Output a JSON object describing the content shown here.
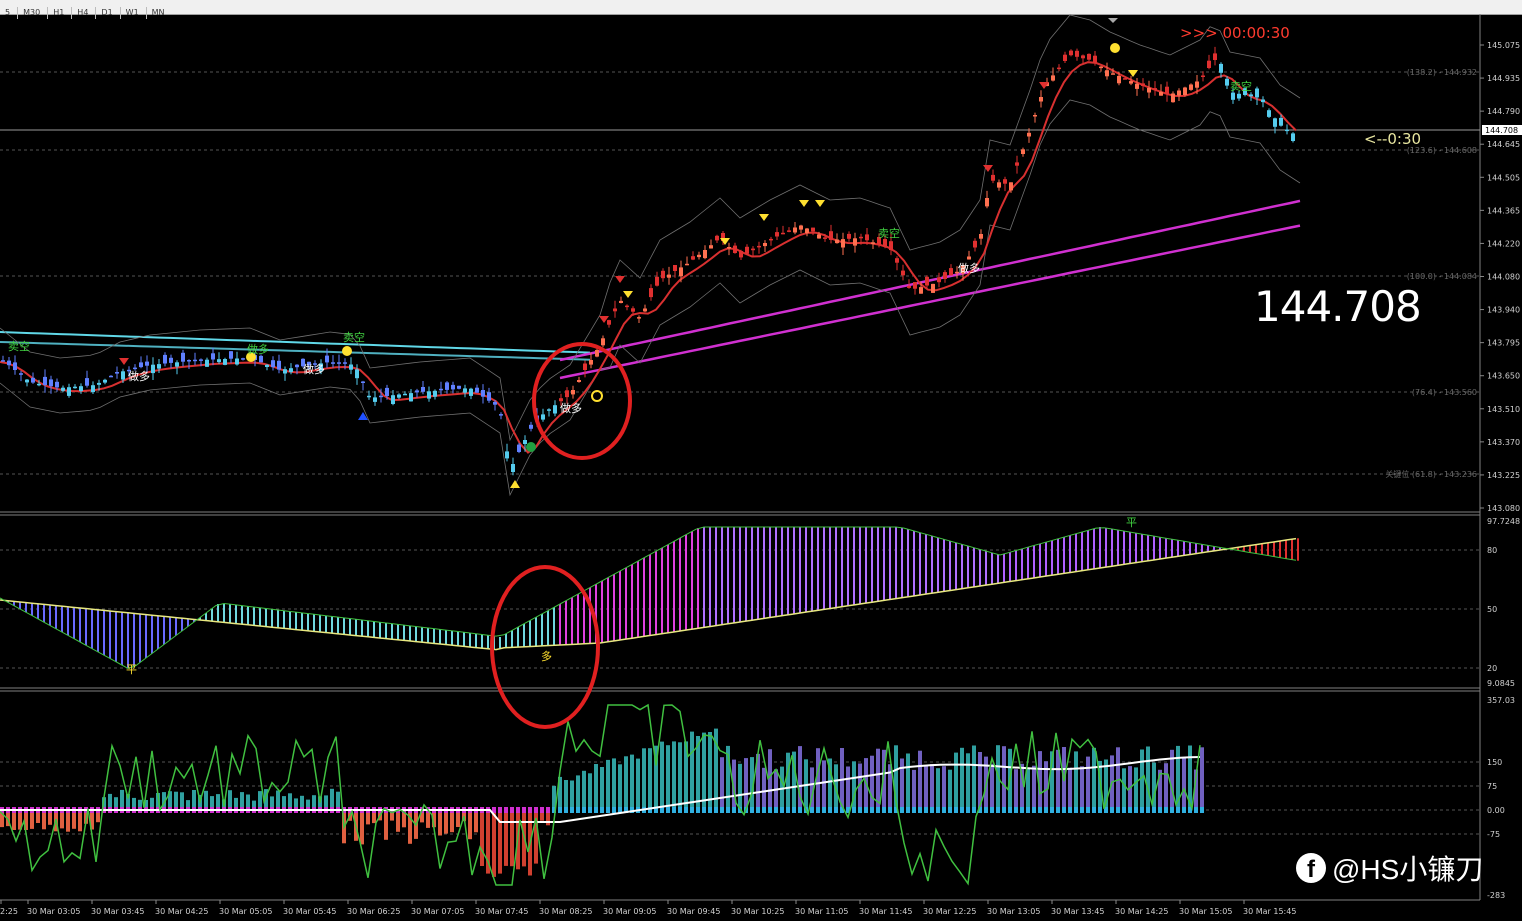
{
  "toolbar": {
    "timeframes": [
      "5",
      "M30",
      "H1",
      "H4",
      "D1",
      "W1",
      "MN"
    ]
  },
  "main_panel": {
    "current_price": "144.708",
    "big_price": "144.708",
    "countdown": ">>> 00:00:30",
    "side_timer": "<--0:30",
    "price_axis": [
      "145.075",
      "144.935",
      "144.790",
      "144.645",
      "144.505",
      "144.365",
      "144.220",
      "144.080",
      "143.940",
      "143.795",
      "143.650",
      "143.510",
      "143.370",
      "143.225",
      "143.080"
    ],
    "fib_levels": [
      "(138.2) - 144.932",
      "(123.6) - 144.608",
      "(100.0) - 144.084",
      "(76.4) - 143.560",
      "关键位 (61.8) - 143.236"
    ],
    "signals": [
      "卖空",
      "做多",
      "做多",
      "卖空",
      "做多",
      "卖空",
      "卖空",
      "做多",
      "做多"
    ]
  },
  "osc_panel": {
    "axis": [
      "97.7248",
      "80",
      "50",
      "20",
      "9.0845"
    ],
    "labels": [
      "平",
      "多",
      "平"
    ]
  },
  "hist_panel": {
    "axis": [
      "357.03",
      "150",
      "75",
      "0.00",
      "-75",
      "-283"
    ]
  },
  "time_axis": [
    "2:25",
    "30 Mar 03:05",
    "30 Mar 03:45",
    "30 Mar 04:25",
    "30 Mar 05:05",
    "30 Mar 05:45",
    "30 Mar 06:25",
    "30 Mar 07:05",
    "30 Mar 07:45",
    "30 Mar 08:25",
    "30 Mar 09:05",
    "30 Mar 09:45",
    "30 Mar 10:25",
    "30 Mar 11:05",
    "30 Mar 11:45",
    "30 Mar 12:25",
    "30 Mar 13:05",
    "30 Mar 13:45",
    "30 Mar 14:25",
    "30 Mar 15:05",
    "30 Mar 15:45"
  ],
  "watermark": {
    "icon": "facebook-icon",
    "text": "@HS小镰刀"
  },
  "colors": {
    "bull": "#55ccee",
    "bear": "#e03030",
    "fast_ma": "#d83030",
    "magenta_ma": "#d030d0",
    "cyan_ma": "#60d8e8"
  }
}
